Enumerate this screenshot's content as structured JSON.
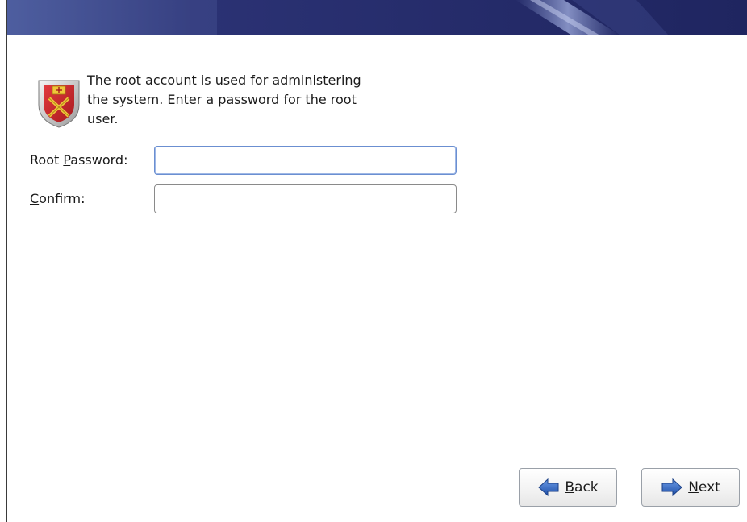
{
  "intro": {
    "text": "The root account is used for administering\nthe system.  Enter a password for the root\nuser."
  },
  "form": {
    "root_password_label_mnemonic": "P",
    "root_password_label_prefix": "Root ",
    "root_password_label_suffix": "assword:",
    "root_password_value": "",
    "confirm_label_mnemonic": "C",
    "confirm_label_suffix": "onfirm:",
    "confirm_value": ""
  },
  "buttons": {
    "back_mnemonic": "B",
    "back_rest": "ack",
    "next_mnemonic": "N",
    "next_rest": "ext"
  },
  "icons": {
    "intro": "shield-icon",
    "back": "left-arrow-icon",
    "next": "right-arrow-icon"
  },
  "colors": {
    "banner": "#232a66",
    "input_focus_border": "#6b8fd1",
    "arrow_blue": "#2e5fb8",
    "shield_red": "#c8262b"
  }
}
